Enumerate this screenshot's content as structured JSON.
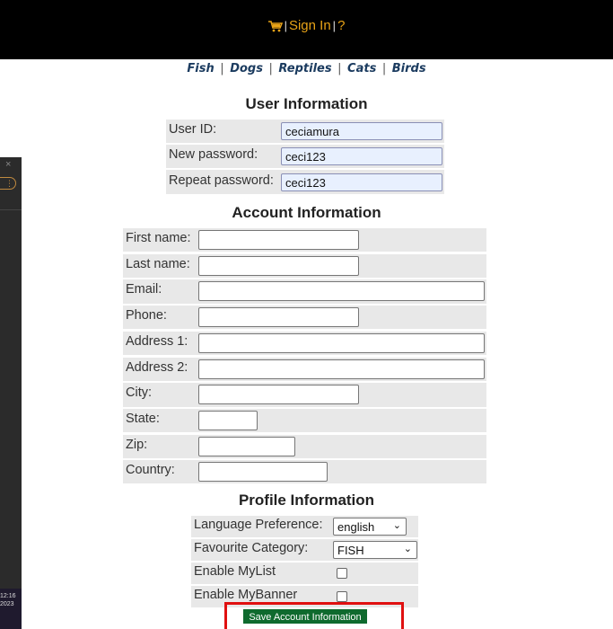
{
  "header": {
    "sign_in": "Sign In",
    "help": "?",
    "sep1": "|",
    "sep2": "|"
  },
  "quicklinks": [
    "Fish",
    "Dogs",
    "Reptiles",
    "Cats",
    "Birds"
  ],
  "quicklink_sep": "|",
  "user_info": {
    "title": "User Information",
    "user_id_label": "User ID:",
    "user_id_value": "ceciamura",
    "new_password_label": "New password:",
    "new_password_value": "ceci123",
    "repeat_password_label": "Repeat password:",
    "repeat_password_value": "ceci123"
  },
  "account_info": {
    "title": "Account Information",
    "first_name_label": "First name:",
    "last_name_label": "Last name:",
    "email_label": "Email:",
    "phone_label": "Phone:",
    "address1_label": "Address 1:",
    "address2_label": "Address 2:",
    "city_label": "City:",
    "state_label": "State:",
    "zip_label": "Zip:",
    "country_label": "Country:"
  },
  "profile_info": {
    "title": "Profile Information",
    "language_label": "Language Preference:",
    "language_value": "english",
    "category_label": "Favourite Category:",
    "category_value": "FISH",
    "mylist_label": "Enable MyList",
    "mybanner_label": "Enable MyBanner"
  },
  "save_button": "Save Account Information",
  "side_window": {
    "close": "×",
    "time": "12:16",
    "year": "2023"
  },
  "colors": {
    "topbar": "#000000",
    "menu_text": "#e8a317",
    "row_bg": "#e8e8e8",
    "save_button_bg": "#0f6a2e",
    "highlight": "#e01010"
  }
}
